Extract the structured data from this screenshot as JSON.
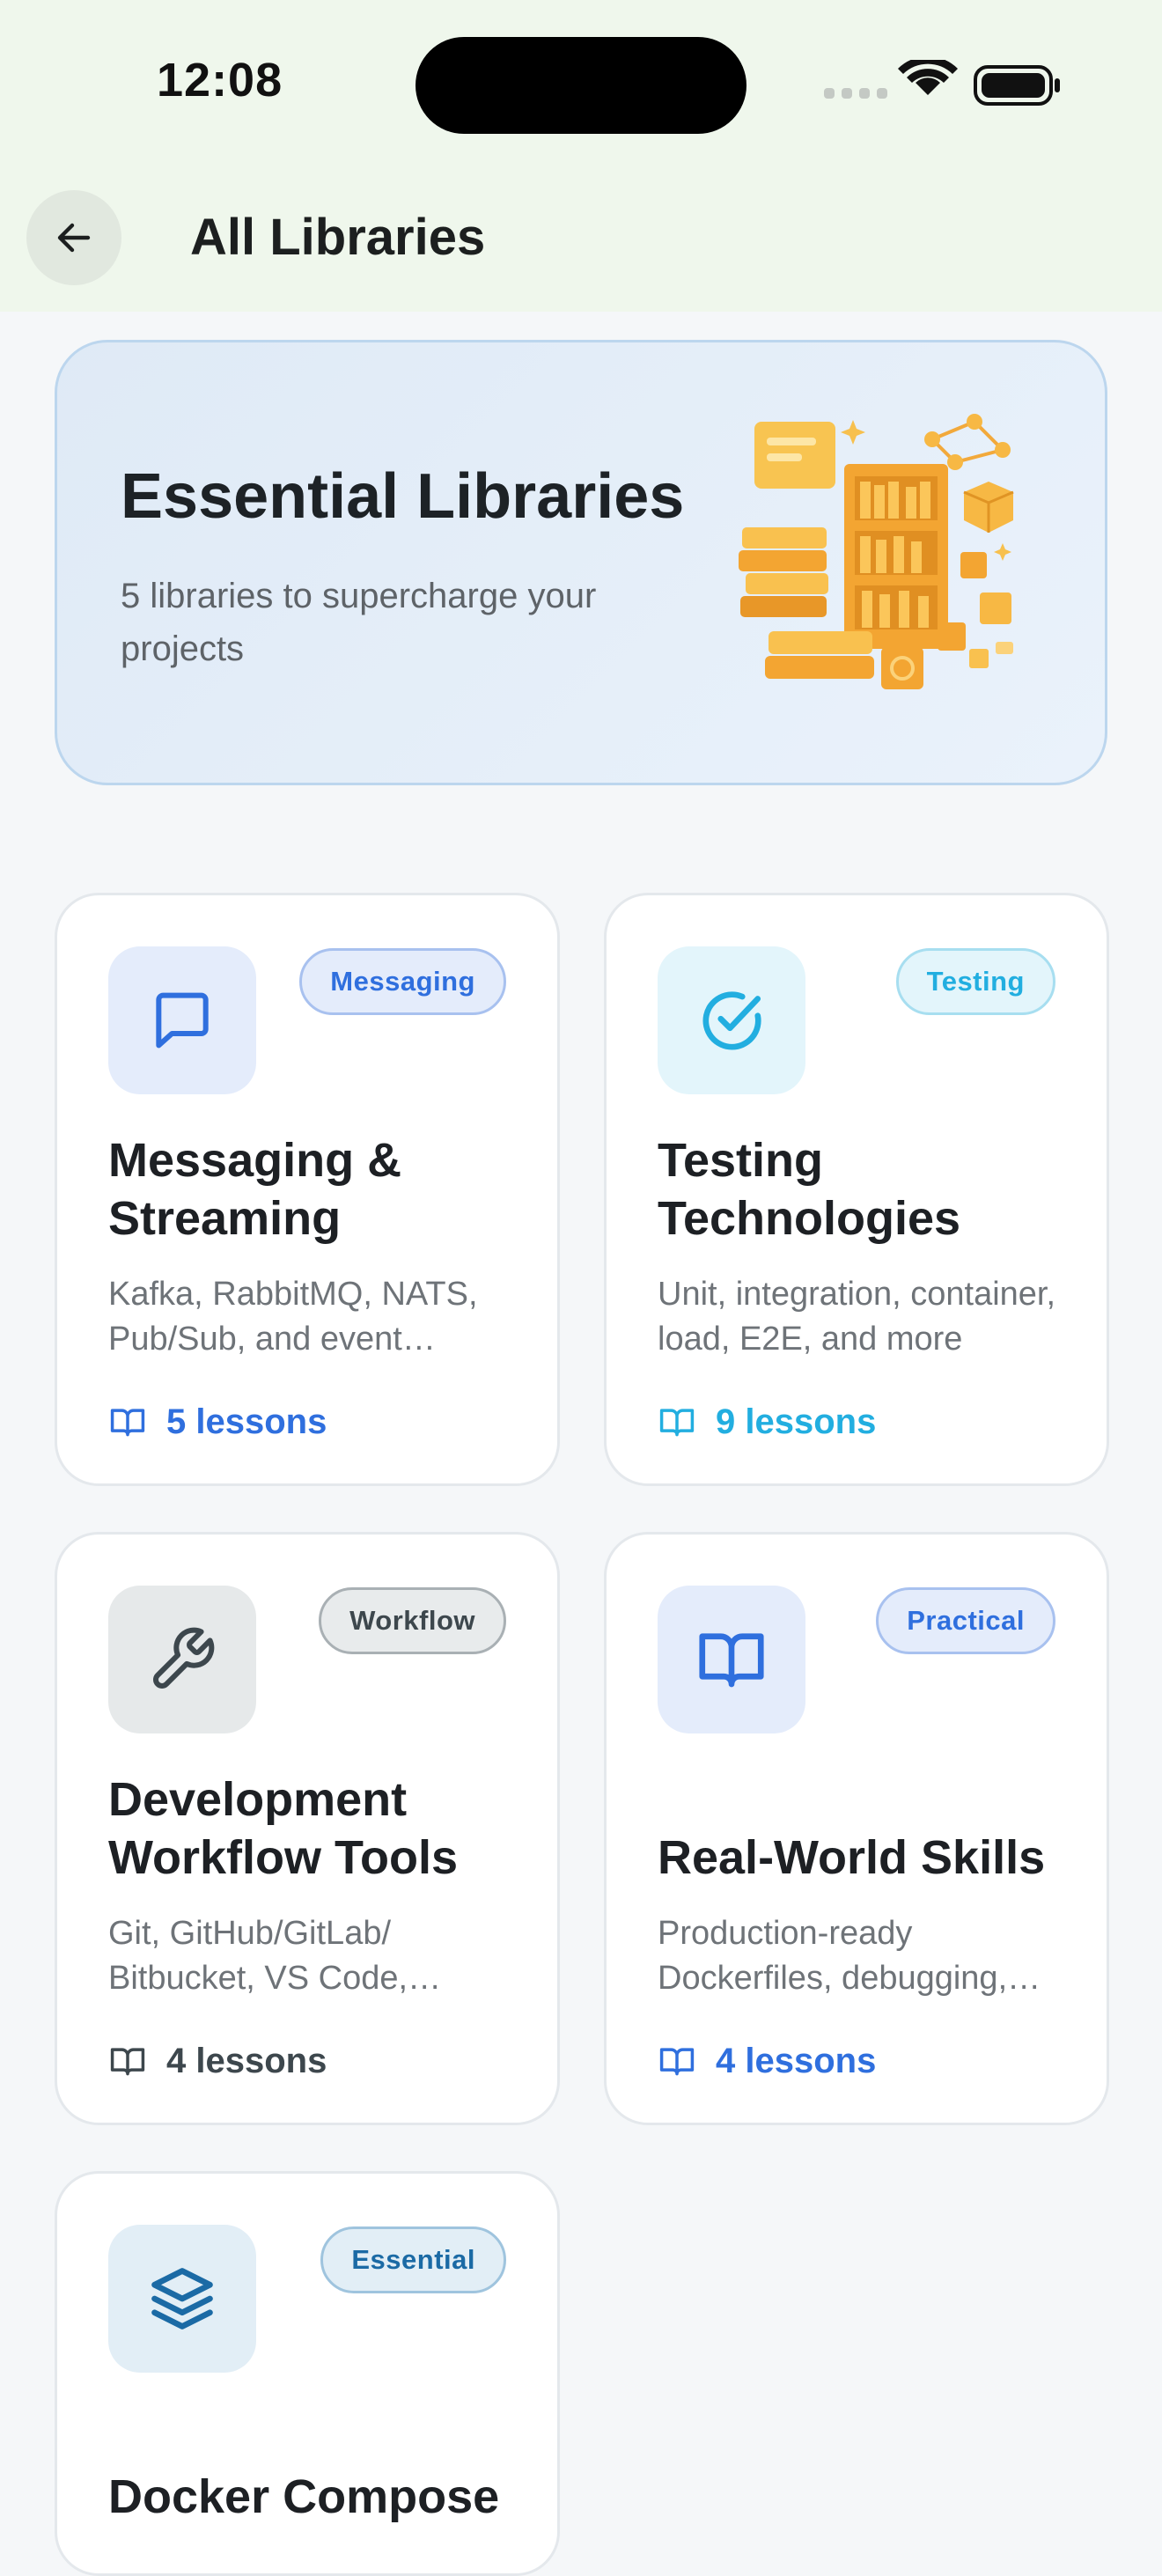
{
  "status_bar": {
    "time": "12:08"
  },
  "header": {
    "title": "All Libraries",
    "back_icon": "arrow-left-icon"
  },
  "hero": {
    "title": "Essential Libraries",
    "subtitle": "5 libraries to supercharge your projects",
    "illustration": "library-bookshelf-illustration"
  },
  "colors": {
    "header_bg": "#eff7ec",
    "page_bg": "#f5f7f9",
    "hero_bg": "#e4eef8",
    "illustration_gold": "#f6b63c"
  },
  "cards": [
    {
      "title": "Messaging & Streaming",
      "description": "Kafka, RabbitMQ, NATS, Pub/Sub, and event streaming",
      "badge": "Messaging",
      "lessons": "5 lessons",
      "icon": "chat-bubble-icon",
      "accent": "#2f6fde",
      "tile_bg": "#e4ecfb",
      "badge_bg": "#e4ecfb",
      "badge_border": "#a8c1ef"
    },
    {
      "title": "Testing Technologies",
      "description": "Unit, integration, container, load, E2E, and more",
      "badge": "Testing",
      "lessons": "9 lessons",
      "icon": "check-circle-icon",
      "accent": "#22aee0",
      "tile_bg": "#e3f5fb",
      "badge_bg": "#e3f5fb",
      "badge_border": "#a7def0"
    },
    {
      "title": "Development Workflow Tools",
      "description": "Git, GitHub/GitLab/ Bitbucket, VS Code, JetBrains",
      "badge": "Workflow",
      "lessons": "4 lessons",
      "icon": "wrench-icon",
      "accent": "#3d474d",
      "tile_bg": "#e6e9ea",
      "badge_bg": "#e8ebec",
      "badge_border": "#a9b0b4"
    },
    {
      "title": "Real-World Skills",
      "description": "Production-ready Dockerfiles, debugging, and more",
      "badge": "Practical",
      "lessons": "4 lessons",
      "icon": "open-book-icon",
      "accent": "#2f6fde",
      "tile_bg": "#e4ecfb",
      "badge_bg": "#e4ecfb",
      "badge_border": "#a8c1ef"
    },
    {
      "title": "Docker Compose",
      "badge": "Essential",
      "icon": "layers-stack-icon",
      "accent": "#1b6aa5",
      "tile_bg": "#e2eef6",
      "badge_bg": "#e2eef6",
      "badge_border": "#9fc4de"
    }
  ]
}
